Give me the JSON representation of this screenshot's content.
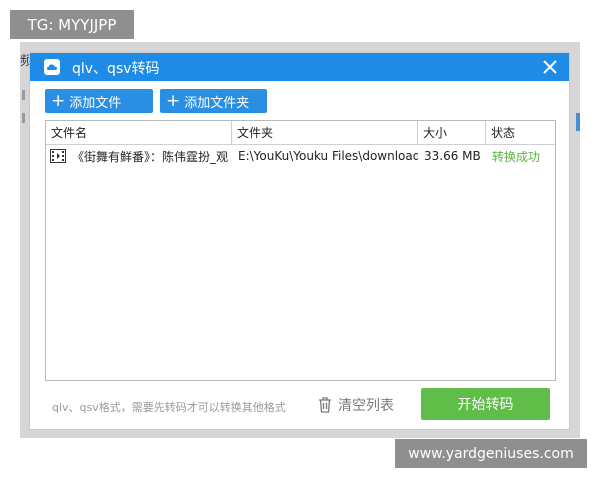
{
  "watermarks": {
    "top_left": "TG: MYYJJPP",
    "bottom_right": "www.yardgeniuses.com"
  },
  "backdrop": {
    "fragment": "频"
  },
  "dialog": {
    "title": "qlv、qsv转码",
    "toolbar": {
      "add_file": "添加文件",
      "add_folder": "添加文件夹"
    },
    "table": {
      "headers": {
        "name": "文件名",
        "folder": "文件夹",
        "size": "大小",
        "status": "状态"
      },
      "rows": [
        {
          "name": "《街舞有鲜番》：陈伟霆扮_观",
          "folder": "E:\\YouKu\\Youku Files\\download",
          "size": "33.66 MB",
          "status": "转换成功"
        }
      ]
    },
    "footer": {
      "hint": "qlv、qsv格式，需要先转码才可以转换其他格式",
      "clear_label": "清空列表",
      "start_label": "开始转码"
    },
    "colors": {
      "titlebar": "#1e8be6",
      "button": "#2a8fe2",
      "start": "#5fbd48",
      "status_ok": "#58b83a"
    },
    "icons": {
      "app": "cloud-icon",
      "close": "close-icon",
      "add": "plus-icon",
      "file": "video-file-icon",
      "clear": "trash-icon"
    }
  }
}
